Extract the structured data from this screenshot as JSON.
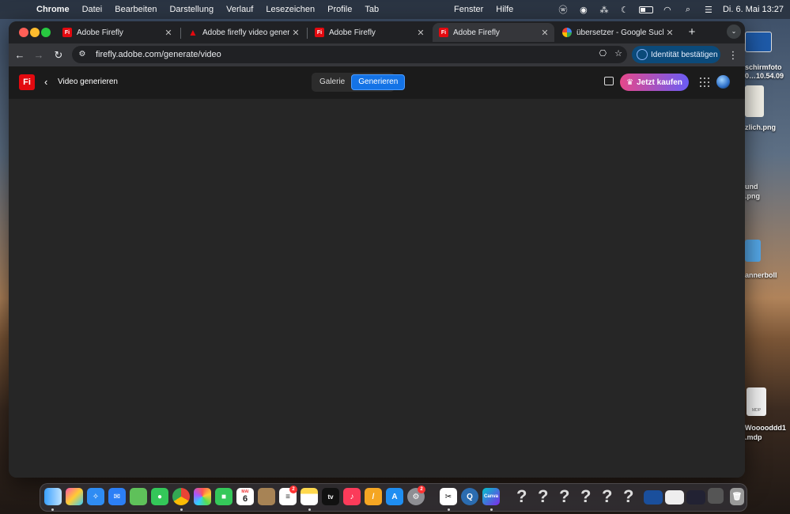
{
  "menubar": {
    "app": "Chrome",
    "menus": [
      "Datei",
      "Bearbeiten",
      "Darstellung",
      "Verlauf",
      "Lesezeichen",
      "Profile",
      "Tab"
    ],
    "menus_right": [
      "Fenster",
      "Hilfe"
    ],
    "clock": "Di. 6. Mai  13:27"
  },
  "desktop": {
    "files": [
      "schirmfoto",
      "0…10.54.09",
      "zlich.png",
      "und",
      ".png",
      "annerboll",
      "Wooooddd1",
      ".mdp"
    ],
    "mdp_badge": "MDP"
  },
  "tabs": [
    {
      "title": "Adobe Firefly",
      "favicon": "firefly",
      "active": false
    },
    {
      "title": "Adobe firefly video generatio",
      "favicon": "adobe",
      "active": false
    },
    {
      "title": "Adobe Firefly",
      "favicon": "firefly",
      "active": false
    },
    {
      "title": "Adobe Firefly",
      "favicon": "firefly",
      "active": true
    },
    {
      "title": "übersetzer - Google Suche",
      "favicon": "google",
      "active": false
    }
  ],
  "toolbar": {
    "url": "firefly.adobe.com/generate/video",
    "identity_label": "Identität bestätigen"
  },
  "app": {
    "logo_text": "Fi",
    "page_title": "Video generieren",
    "segments": [
      "Galerie",
      "Generieren"
    ],
    "active_segment": "Generieren",
    "buy_label": "Jetzt kaufen"
  },
  "dock": {
    "calendar_month": "MAI",
    "calendar_day": "6",
    "badges": {
      "reminders": "2",
      "settings": "2"
    },
    "tv_label": "tv",
    "canva_label": "Canva"
  },
  "colors": {
    "accent": "#1473e6",
    "firefly_red": "#e3090f",
    "buy_gradient_start": "#e6488a",
    "buy_gradient_end": "#6a5cf5"
  }
}
